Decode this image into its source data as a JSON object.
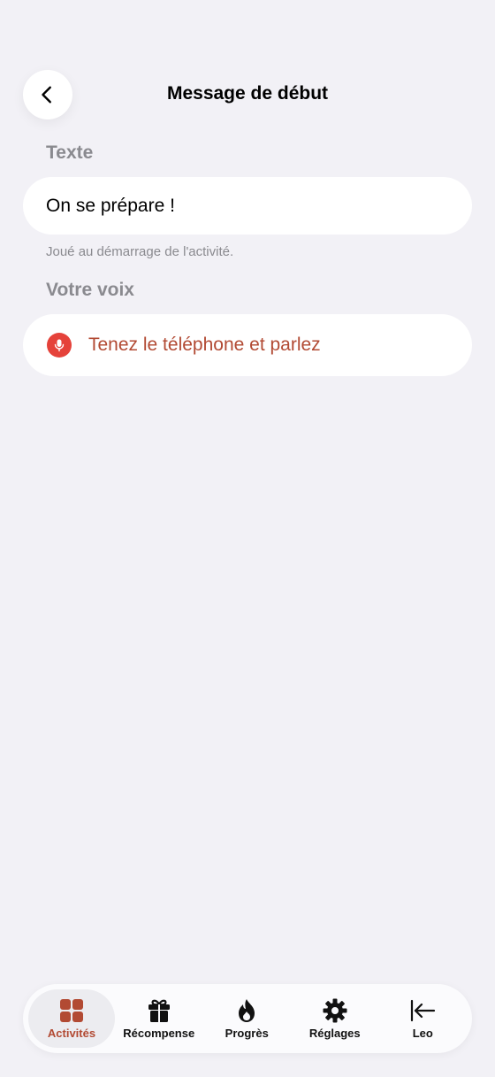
{
  "header": {
    "title": "Message de début",
    "back_icon": "chevron-left-icon"
  },
  "text_section": {
    "label": "Texte",
    "value": "On se prépare !",
    "helper": "Joué au démarrage de l'activité."
  },
  "voice_section": {
    "label": "Votre voix",
    "record_label": "Tenez le téléphone et parlez",
    "icon": "microphone-icon",
    "accent_color": "#e5423a"
  },
  "tab_bar": {
    "active_index": 0,
    "active_color": "#b24a33",
    "tabs": [
      {
        "label": "Activités",
        "icon": "grid-icon"
      },
      {
        "label": "Récompense",
        "icon": "gift-icon"
      },
      {
        "label": "Progrès",
        "icon": "flame-icon"
      },
      {
        "label": "Réglages",
        "icon": "gear-icon"
      },
      {
        "label": "Leo",
        "icon": "arrow-left-bar-icon"
      }
    ]
  }
}
